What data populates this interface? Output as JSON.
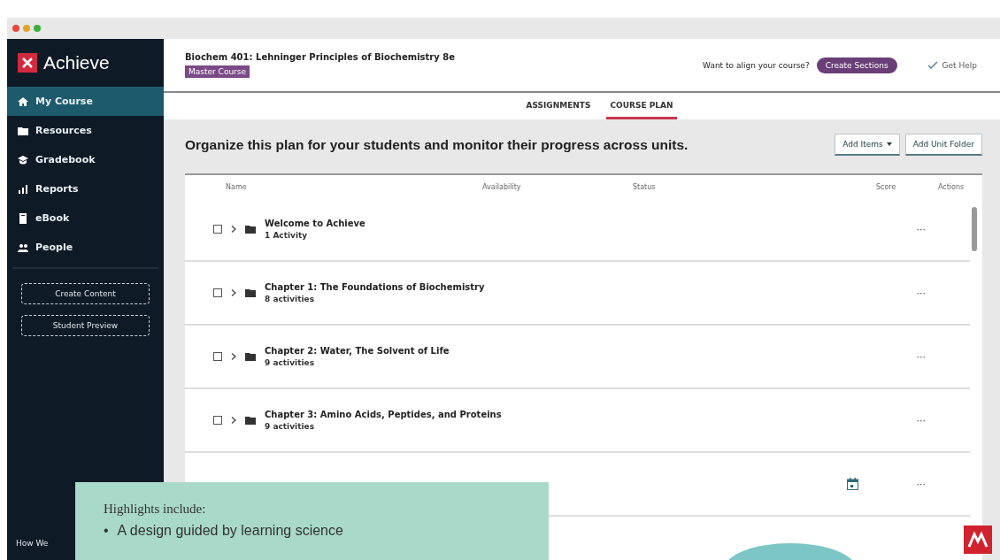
{
  "sidebar": {
    "logo": "Achieve",
    "items": [
      {
        "label": "My Course",
        "selected": true
      },
      {
        "label": "Resources",
        "selected": false
      },
      {
        "label": "Gradebook",
        "selected": false
      },
      {
        "label": "Reports",
        "selected": false
      },
      {
        "label": "eBook",
        "selected": false
      },
      {
        "label": "People",
        "selected": false
      }
    ],
    "buttons": [
      "Create Content",
      "Student Preview"
    ],
    "footer": "How We"
  },
  "header": {
    "course_title": "Biochem 401: Lehninger Principles of Biochemistry 8e",
    "badge": "Master Course",
    "prompt": "Want to align your course?",
    "action": "Create Sections",
    "help": "Get Help"
  },
  "tabs": [
    {
      "label": "ASSIGNMENTS",
      "selected": false
    },
    {
      "label": "COURSE PLAN",
      "selected": true
    }
  ],
  "intro": "Organize this plan for your students and monitor their progress across units.",
  "toolbar": [
    {
      "label": "Add Items",
      "dropdown": true
    },
    {
      "label": "Add Unit Folder",
      "dropdown": false
    }
  ],
  "table": {
    "columns": [
      "Name",
      "Availability",
      "Status",
      "Score",
      "Actions"
    ],
    "rows": [
      {
        "title": "Welcome to Achieve",
        "subtitle": "1 Activity",
        "checked": false,
        "menu": "···"
      },
      {
        "title": "Chapter 1: The Foundations of Biochemistry",
        "subtitle": "8 activities",
        "checked": false,
        "menu": "···"
      },
      {
        "title": "Chapter 2: Water, The Solvent of Life",
        "subtitle": "9 activities",
        "checked": false,
        "menu": "···"
      },
      {
        "title": "Chapter 3: Amino Acids, Peptides, and Proteins",
        "subtitle": "9 activities",
        "checked": false,
        "menu": "···"
      },
      {
        "date_icon": true,
        "menu": "···"
      }
    ]
  },
  "overlay": {
    "heading": "Highlights include:",
    "marker": "•",
    "bullets": [
      "A design guided by learning science"
    ]
  }
}
